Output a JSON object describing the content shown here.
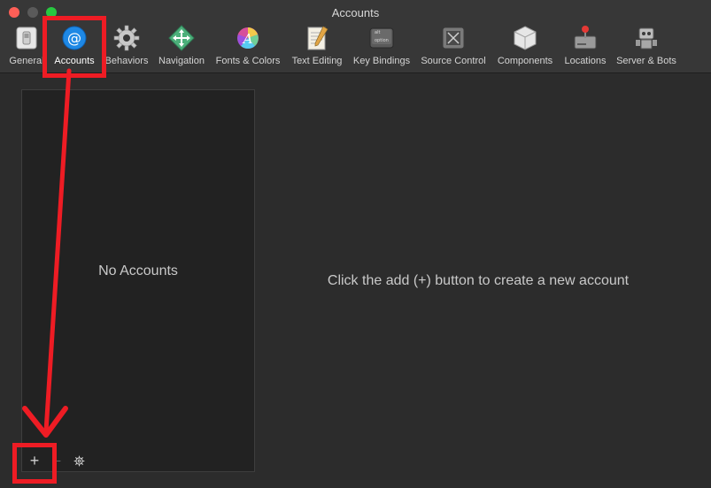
{
  "window": {
    "title": "Accounts"
  },
  "toolbar": {
    "items": [
      {
        "label": "General",
        "icon": "general-switch-icon"
      },
      {
        "label": "Accounts",
        "icon": "at-sign-icon",
        "selected": true
      },
      {
        "label": "Behaviors",
        "icon": "gear-icon"
      },
      {
        "label": "Navigation",
        "icon": "arrows-icon"
      },
      {
        "label": "Fonts & Colors",
        "icon": "color-wheel-icon"
      },
      {
        "label": "Text Editing",
        "icon": "notepad-icon"
      },
      {
        "label": "Key Bindings",
        "icon": "option-key-icon"
      },
      {
        "label": "Source Control",
        "icon": "source-control-icon"
      },
      {
        "label": "Components",
        "icon": "components-box-icon"
      },
      {
        "label": "Locations",
        "icon": "hard-drive-icon"
      },
      {
        "label": "Server & Bots",
        "icon": "robot-icon"
      }
    ]
  },
  "accounts": {
    "empty_label": "No Accounts",
    "hint": "Click the add (+) button to create a new account",
    "add_symbol": "+",
    "remove_symbol": "−"
  },
  "colors": {
    "annotation": "#ee1c24",
    "accent": "#1e88e5"
  }
}
